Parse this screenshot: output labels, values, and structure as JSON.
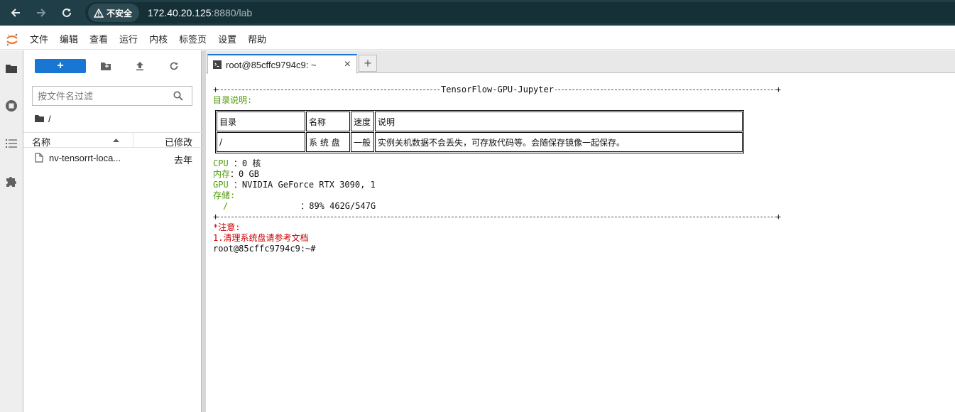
{
  "browser": {
    "security_label": "不安全",
    "url_host": "172.40.20.125",
    "url_rest": ":8880/lab"
  },
  "menu": [
    "文件",
    "编辑",
    "查看",
    "运行",
    "内核",
    "标签页",
    "设置",
    "帮助"
  ],
  "file_browser": {
    "new_label": "+",
    "filter_placeholder": "按文件名过滤",
    "breadcrumb": "/",
    "col_name": "名称",
    "col_modified": "已修改",
    "files": [
      {
        "name": "nv-tensorrt-loca...",
        "modified": "去年"
      }
    ]
  },
  "tab": {
    "label": "root@85cffc9794c9: ~",
    "close": "×",
    "add": "+"
  },
  "terminal": {
    "banner_title": "TensorFlow-GPU-Jupyter",
    "section_title": "目录说明:",
    "table_rows": [
      [
        "目录",
        "名称",
        "速度",
        "说明"
      ],
      [
        "/",
        "系 统 盘",
        "一般",
        "实例关机数据不会丢失，可存放代码等。会随保存镜像一起保存。"
      ]
    ],
    "cpu_label": "CPU",
    "cpu_value": "：0 核",
    "mem_label": "内存",
    "mem_value": "：0 GB",
    "gpu_label": "GPU",
    "gpu_value": "：NVIDIA GeForce RTX 3090, 1",
    "storage_label": "存储:",
    "storage_mount": "/",
    "storage_value": "：89% 462G/547G",
    "notice_title": "*注意:",
    "notice_1": "1.清理系统盘请参考文档",
    "prompt": "root@85cffc9794c9:~#"
  }
}
